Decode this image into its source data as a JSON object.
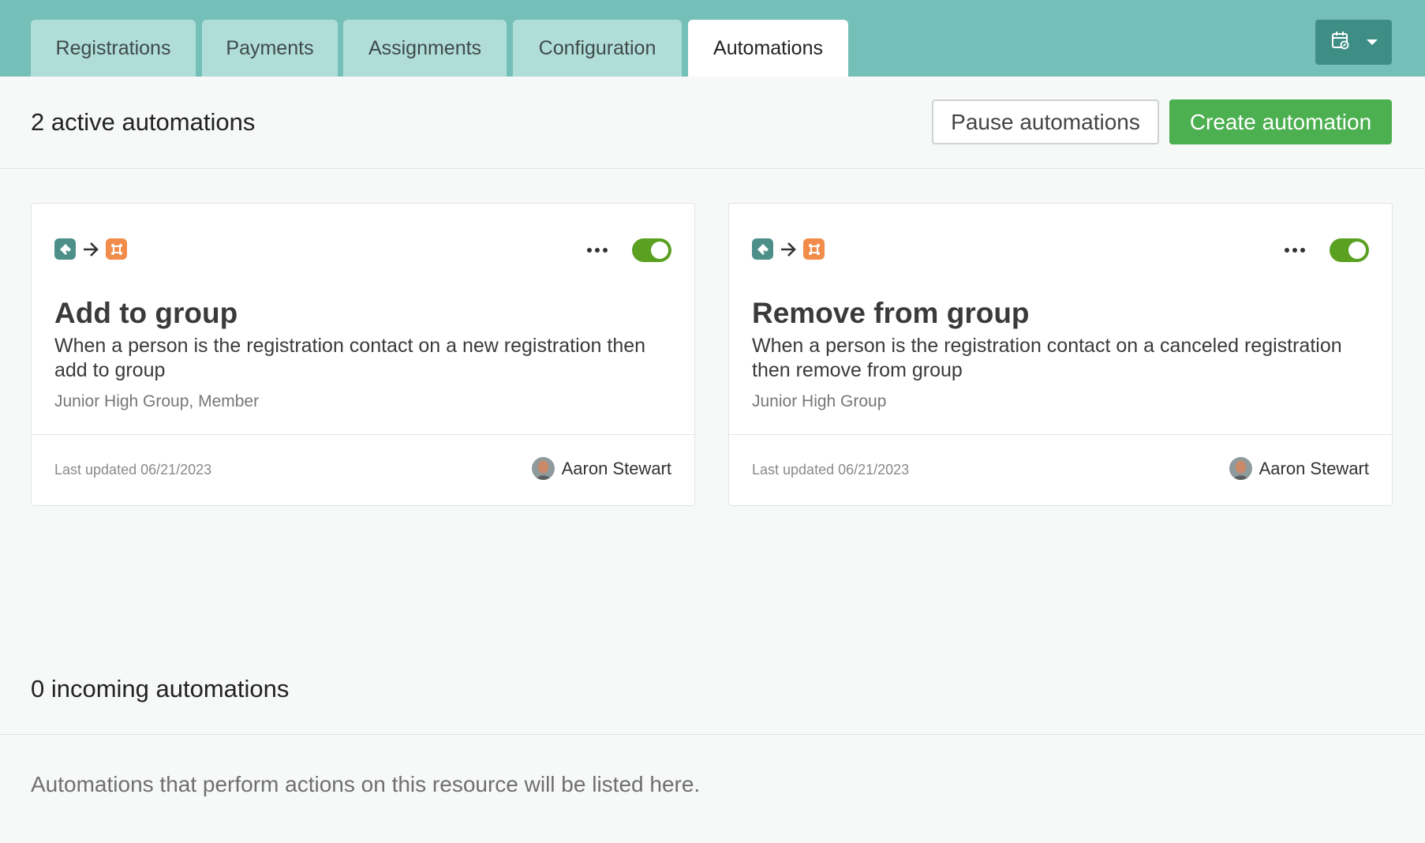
{
  "tabs": [
    {
      "label": "Registrations"
    },
    {
      "label": "Payments"
    },
    {
      "label": "Assignments"
    },
    {
      "label": "Configuration"
    },
    {
      "label": "Automations"
    }
  ],
  "active_tab": "Automations",
  "calendar_button_icon": "calendar-link-icon",
  "header": {
    "title": "2 active automations",
    "pause_label": "Pause automations",
    "create_label": "Create automation"
  },
  "cards": [
    {
      "title": "Add to group",
      "description": "When a person is the registration contact on a new registration then add to group",
      "meta": "Junior High Group, Member",
      "updated": "Last updated 06/21/2023",
      "user": "Aaron Stewart",
      "enabled": true
    },
    {
      "title": "Remove from group",
      "description": "When a person is the registration contact on a canceled registration then remove from group",
      "meta": "Junior High Group",
      "updated": "Last updated 06/21/2023",
      "user": "Aaron Stewart",
      "enabled": true
    }
  ],
  "incoming": {
    "title": "0 incoming automations",
    "empty_text": "Automations that perform actions on this resource will be listed here."
  },
  "colors": {
    "tabbar": "#74c0b9",
    "tab": "#b1ddd8",
    "primary_button": "#4caf50",
    "toggle_on": "#5aa021",
    "source_icon": "#4e8f8a",
    "target_icon": "#f28c4b"
  }
}
